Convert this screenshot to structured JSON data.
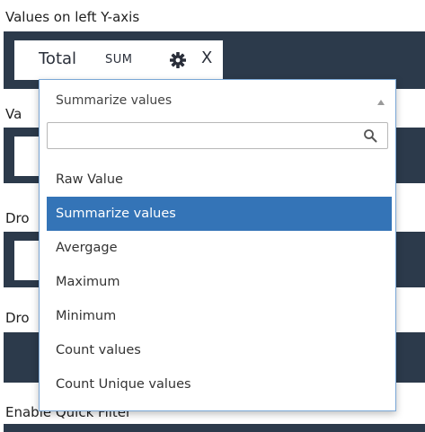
{
  "colors": {
    "panel_bg": "#2c3a4b",
    "highlight": "#3474b7",
    "dropdown_border": "#7aa7d6"
  },
  "sections": {
    "left_axis_label": "Values on left Y-axis",
    "partial_label_1": "Va",
    "partial_label_2": "Dro",
    "partial_label_3": "Dro",
    "quick_filter_label": "Enable Quick Filter"
  },
  "chip": {
    "field_name": "Total",
    "aggregation": "SUM",
    "settings_icon": "gear-icon",
    "remove_label": "X"
  },
  "dropdown": {
    "selected_value": "Summarize values",
    "search_placeholder": "",
    "search_icon": "search-icon",
    "options": [
      "Raw Value",
      "Summarize values",
      "Avergage",
      "Maximum",
      "Minimum",
      "Count values",
      "Count Unique values"
    ],
    "highlighted_index": 1
  }
}
